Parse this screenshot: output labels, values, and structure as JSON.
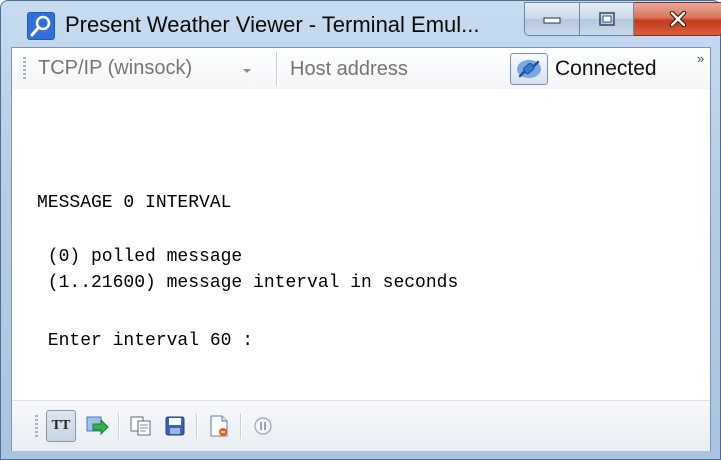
{
  "window": {
    "title": "Present Weather Viewer - Terminal Emul...",
    "buttons": {
      "minimize": "minimize",
      "maximize": "maximize",
      "close": "close"
    }
  },
  "toolbar": {
    "connection_type": "TCP/IP (winsock)",
    "host_placeholder": "Host address",
    "status_label": "Connected",
    "overflow": "»"
  },
  "terminal": {
    "lines": [
      "MESSAGE 0 INTERVAL",
      " (0) polled message",
      " (1..21600) message interval in seconds",
      " Enter interval 60 :"
    ]
  },
  "bottom_toolbar": {
    "tt_label": "TT",
    "icons": [
      "tt-toggle-icon",
      "send-icon",
      "copy-icon",
      "save-icon",
      "log-file-icon",
      "pause-icon"
    ]
  },
  "colors": {
    "close_button": "#c2391b",
    "frame": "#b5cde6"
  }
}
